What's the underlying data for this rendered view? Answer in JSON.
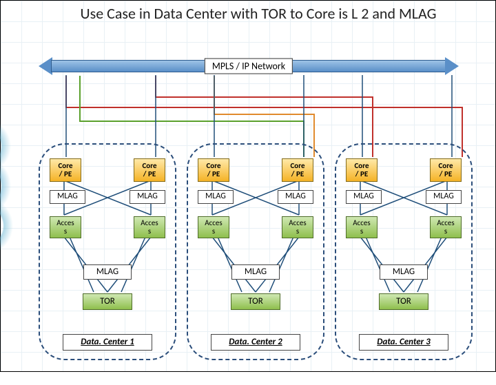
{
  "title": "Use Case in Data Center with TOR to Core is L 2 and MLAG",
  "network_label": "MPLS / IP Network",
  "labels": {
    "core": "Core\n/ PE",
    "mlag": "MLAG",
    "access": "Acces\ns",
    "tor": "TOR"
  },
  "datacenters": [
    {
      "name": "Data. Center 1"
    },
    {
      "name": "Data. Center 2"
    },
    {
      "name": "Data. Center 3"
    }
  ]
}
